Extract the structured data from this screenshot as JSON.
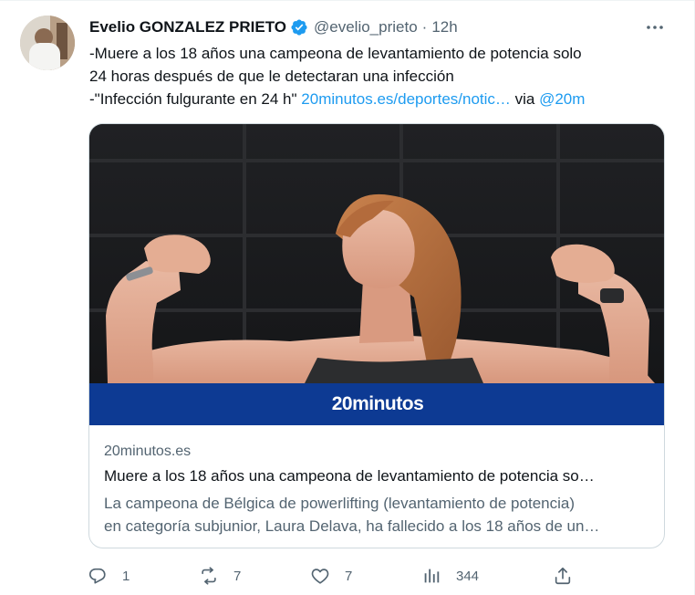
{
  "tweet": {
    "author_name": "Evelio GONZALEZ PRIETO",
    "handle": "@evelio_prieto",
    "separator": "·",
    "time": "12h",
    "text_line1": "-Muere a los 18 años una campeona de levantamiento de potencia solo",
    "text_line2": "24 horas después de que le detectaran una infección",
    "text_line3_prefix": "-\"Infección fulgurante en 24 h\" ",
    "link_text": "20minutos.es/deportes/notic…",
    "via_text": " via ",
    "mention": "@20m"
  },
  "card": {
    "brand": "20minutos",
    "domain": "20minutos.es",
    "title": "Muere a los 18 años una campeona de levantamiento de potencia so…",
    "description_line1": "La campeona de Bélgica de powerlifting (levantamiento de potencia)",
    "description_line2": "en categoría subjunior, Laura Delava, ha fallecido a los 18 años de un…",
    "brand_color": "#0d3a93"
  },
  "actions": {
    "reply_count": "1",
    "retweet_count": "7",
    "like_count": "7",
    "views_count": "344"
  },
  "icons": {
    "verified": "verified-badge-icon",
    "more": "more-icon",
    "reply": "reply-icon",
    "retweet": "retweet-icon",
    "like": "heart-icon",
    "views": "views-icon",
    "share": "share-icon"
  },
  "colors": {
    "link": "#1d9bf0",
    "secondary_text": "#536471",
    "primary_text": "#0f1419"
  }
}
